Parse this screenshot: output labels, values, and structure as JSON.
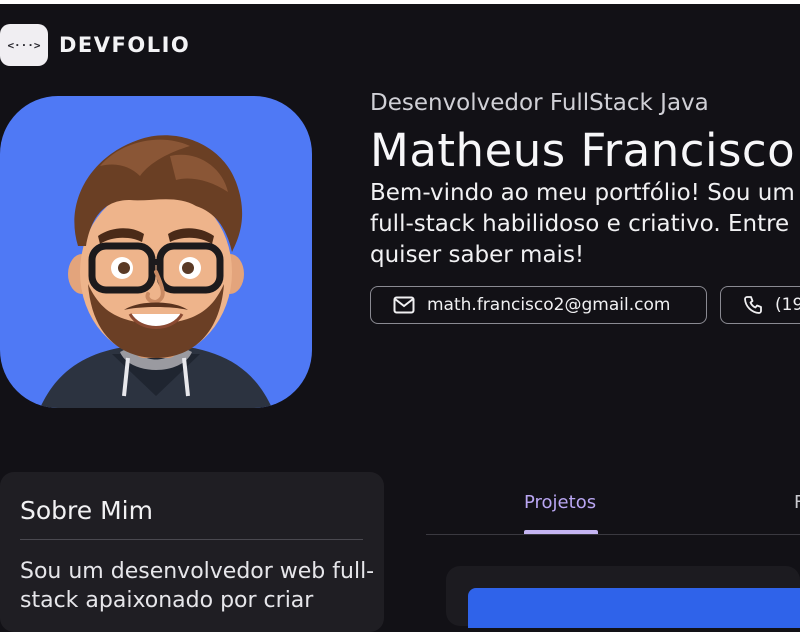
{
  "brand": {
    "logo_glyph": "<···>",
    "name": "DEVFOLIO"
  },
  "profile": {
    "role": "Desenvolvedor FullStack Java",
    "name": "Matheus Francisco",
    "intro_lines": [
      "Bem-vindo ao meu portfólio! Sou um",
      "full-stack habilidoso e criativo. Entre",
      "quiser saber mais!"
    ],
    "avatar_bg": "#4f79f5"
  },
  "contacts": {
    "email": {
      "icon": "mail-icon",
      "text": "math.francisco2@gmail.com"
    },
    "phone": {
      "icon": "phone-icon",
      "text": "(19"
    }
  },
  "about": {
    "title": "Sobre Mim",
    "lines": [
      "Sou um desenvolvedor web full-",
      "stack apaixonado por criar"
    ]
  },
  "tabs": {
    "projects": "Projetos",
    "next": "F"
  },
  "colors": {
    "background": "#121116",
    "card": "#1f1e23",
    "accent": "#b9a6f2",
    "brand_blue": "#2f63ea"
  }
}
